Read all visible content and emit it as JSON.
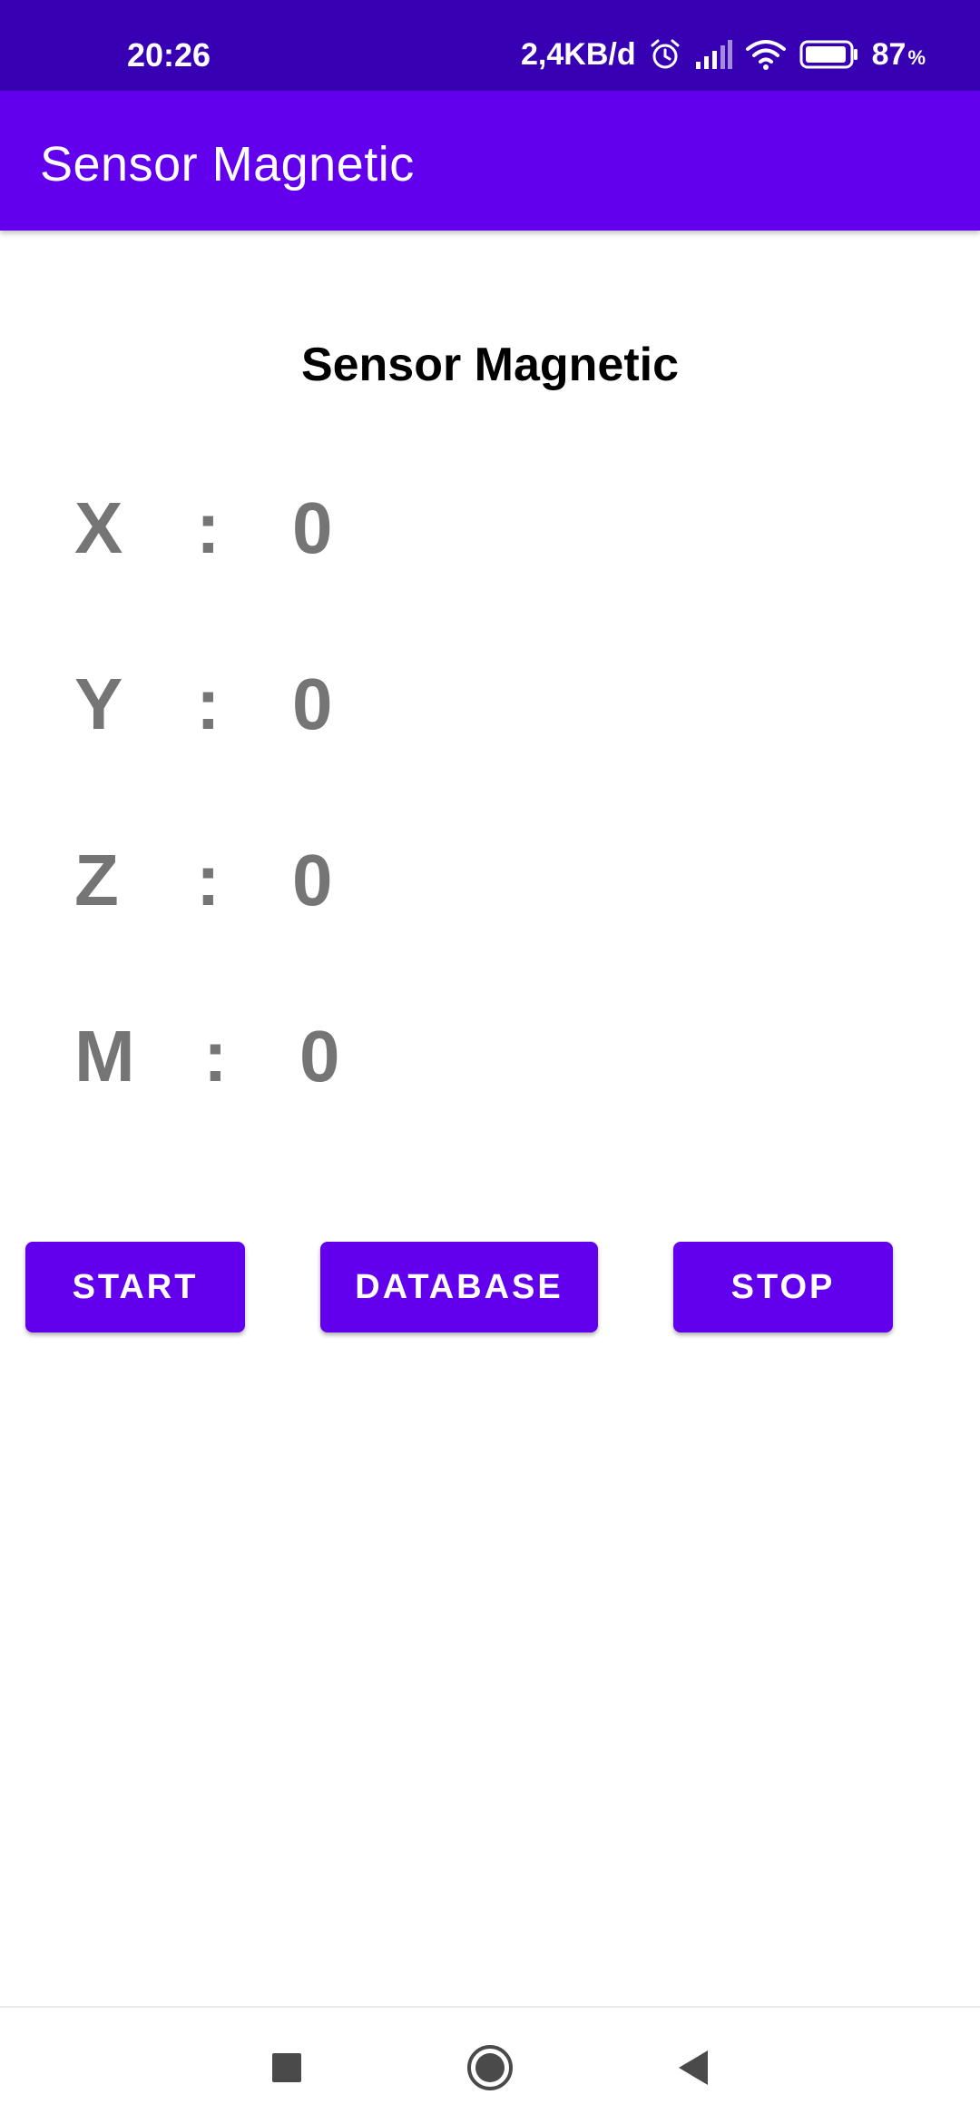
{
  "status_bar": {
    "time": "20:26",
    "network_speed": "2,4KB/d",
    "battery_value": "87",
    "battery_unit": "%",
    "icons": [
      "alarm-icon",
      "signal-icon",
      "wifi-icon",
      "battery-icon"
    ]
  },
  "app_bar": {
    "title": "Sensor Magnetic",
    "color": "#6200ee"
  },
  "main": {
    "heading": "Sensor Magnetic",
    "readings": [
      {
        "axis": "X",
        "separator": ":",
        "value": "0"
      },
      {
        "axis": "Y",
        "separator": ":",
        "value": "0"
      },
      {
        "axis": "Z",
        "separator": ":",
        "value": "0"
      },
      {
        "axis": "M",
        "separator": ":",
        "value": "0"
      }
    ]
  },
  "buttons": {
    "start": "START",
    "database": "DATABASE",
    "stop": "STOP"
  },
  "nav_bar": {
    "icons": [
      "recents-icon",
      "home-icon",
      "back-icon"
    ]
  },
  "colors": {
    "status_bar": "#3700b3",
    "primary": "#6200ee",
    "reading_text": "#757575"
  }
}
